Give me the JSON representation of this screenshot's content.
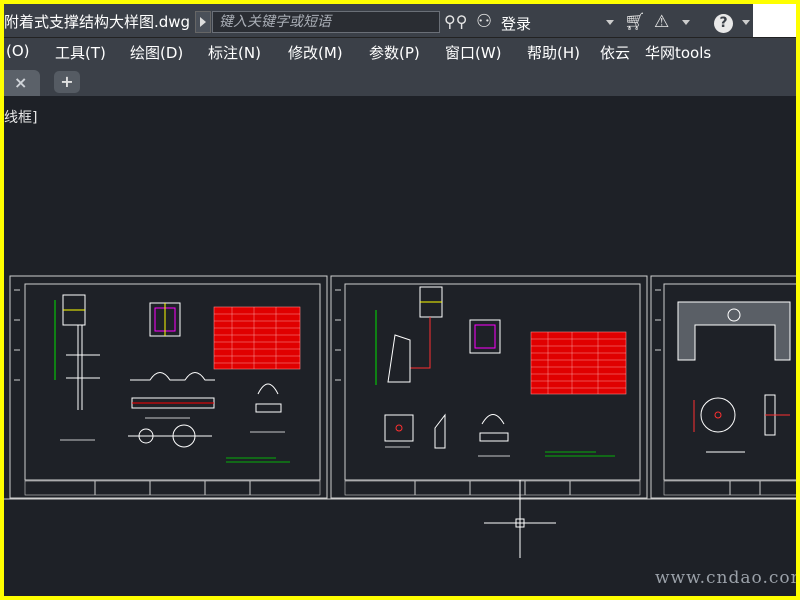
{
  "app": {
    "document_title": "附着式支撑结构大样图.dwg",
    "search_placeholder": "键入关键字或短语",
    "login_label": "登录",
    "help_label": "?"
  },
  "menu": {
    "items": [
      "(O)",
      "工具(T)",
      "绘图(D)",
      "标注(N)",
      "修改(M)",
      "参数(P)",
      "窗口(W)",
      "帮助(H)",
      "依云",
      "华网tools"
    ]
  },
  "tabs": {
    "close_label": "×",
    "add_label": "+"
  },
  "viewport": {
    "label": "线框]"
  },
  "watermark": "www.cndao.com",
  "colors": {
    "frame": "#ffff00",
    "toolbar": "#3b4048",
    "canvas": "#1e2127",
    "table": "#e00000",
    "lines": "#ffffff",
    "green": "#00e000"
  }
}
